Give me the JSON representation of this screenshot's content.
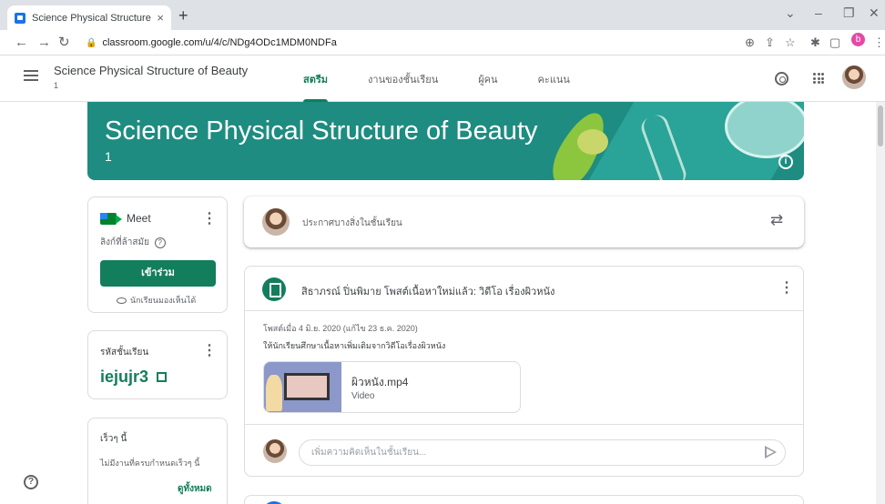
{
  "browser": {
    "tab_title": "Science Physical Structure of Bea",
    "tab_close": "×",
    "new_tab": "+",
    "url": "classroom.google.com/u/4/c/NDg4ODc1MDM0NDFa",
    "profile_letter": "b"
  },
  "header": {
    "title": "Science Physical Structure of Beauty",
    "subtitle": "1",
    "tabs": [
      {
        "label": "สตรีม",
        "active": true
      },
      {
        "label": "งานของชั้นเรียน"
      },
      {
        "label": "ผู้คน"
      },
      {
        "label": "คะแนน"
      }
    ]
  },
  "banner": {
    "title": "Science Physical Structure of Beauty",
    "subtitle": "1",
    "info_glyph": "i",
    "color": "#1e8c80"
  },
  "meet": {
    "title": "Meet",
    "link_label": "ลิงก์ที่ล้าสมัย",
    "help_glyph": "?",
    "join_label": "เข้าร่วม",
    "visible_label": "นักเรียนมองเห็นได้"
  },
  "class_code": {
    "label": "รหัสชั้นเรียน",
    "code": "iejujr3"
  },
  "upcoming": {
    "title": "เร็วๆ นี้",
    "empty": "ไม่มีงานที่ครบกำหนดเร็วๆ นี้",
    "view_all": "ดูทั้งหมด"
  },
  "stream": {
    "announce_placeholder": "ประกาศบางสิ่งในชั้นเรียน",
    "post": {
      "title": "สิธาภรณ์ ปิ่นพิมาย โพสต์เนื้อหาใหม่แล้ว: วิดีโอ เรื่องผิวหนัง",
      "date": "โพสต์เมื่อ 4 มิ.ย. 2020 (แก้ไข 23 ธ.ค. 2020)",
      "body": "ให้นักเรียนศึกษาเนื้อหาเพิ่มเติมจากวิดีโอเรื่องผิวหนัง",
      "attachment_name": "ผิวหนัง.mp4",
      "attachment_type": "Video",
      "comment_placeholder": "เพิ่มความคิดเห็นในชั้นเรียน..."
    }
  },
  "colors": {
    "accent": "#137e5b"
  }
}
